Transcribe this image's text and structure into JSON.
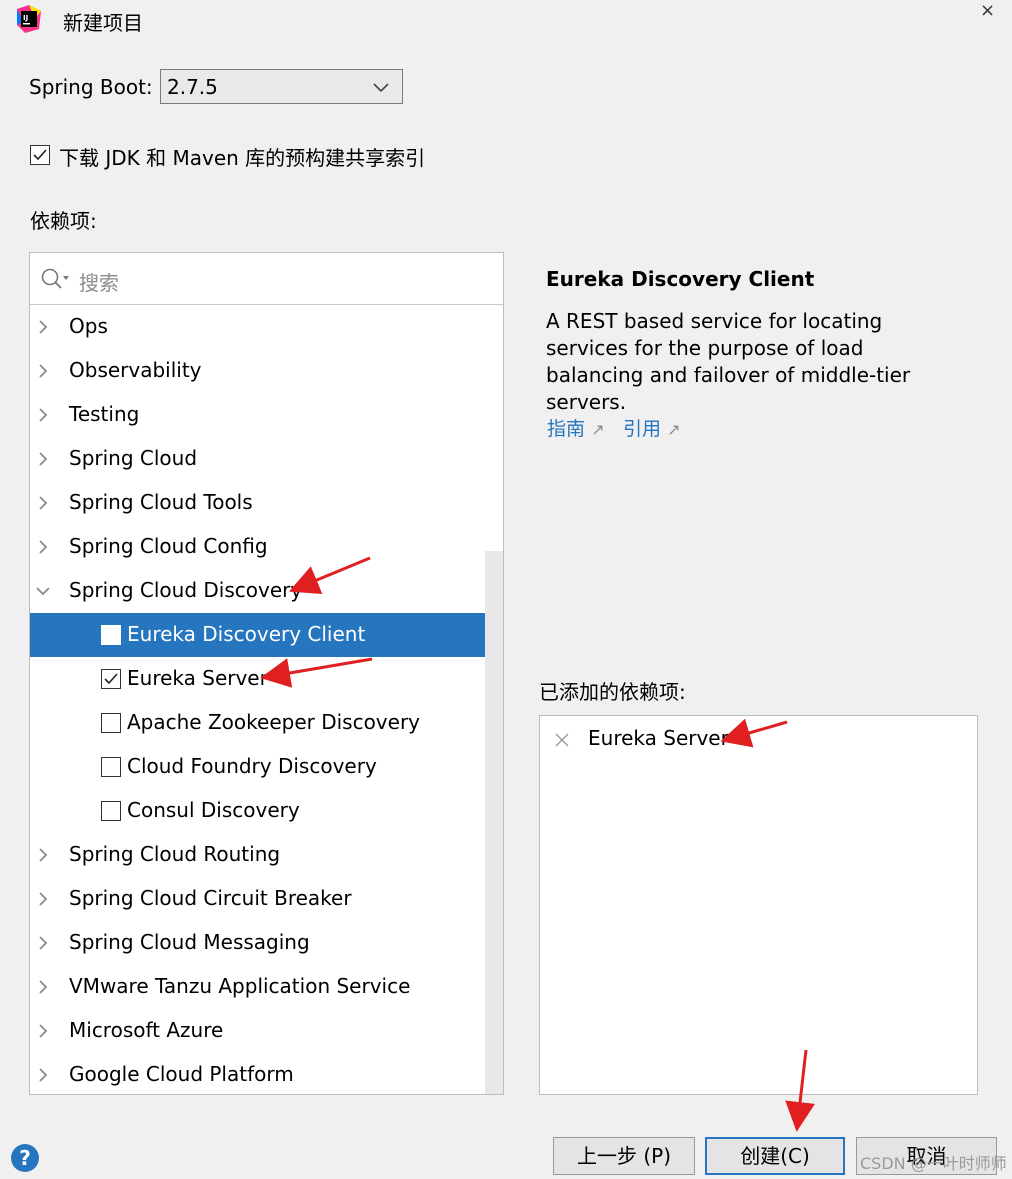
{
  "window": {
    "title": "新建项目",
    "close_symbol": "×"
  },
  "spring_boot": {
    "label": "Spring Boot:",
    "value": "2.7.5"
  },
  "download_index": {
    "label": "下载 JDK 和 Maven 库的预构建共享索引",
    "checked": true
  },
  "dependencies": {
    "label": "依赖项:",
    "search_placeholder": "搜索",
    "rows": [
      {
        "type": "group",
        "label": "Ops",
        "expanded": false
      },
      {
        "type": "group",
        "label": "Observability",
        "expanded": false
      },
      {
        "type": "group",
        "label": "Testing",
        "expanded": false
      },
      {
        "type": "group",
        "label": "Spring Cloud",
        "expanded": false
      },
      {
        "type": "group",
        "label": "Spring Cloud Tools",
        "expanded": false
      },
      {
        "type": "group",
        "label": "Spring Cloud Config",
        "expanded": false
      },
      {
        "type": "group",
        "label": "Spring Cloud Discovery",
        "expanded": true
      },
      {
        "type": "item",
        "label": "Eureka Discovery Client",
        "checked": false,
        "selected": true
      },
      {
        "type": "item",
        "label": "Eureka Server",
        "checked": true,
        "selected": false
      },
      {
        "type": "item",
        "label": "Apache Zookeeper Discovery",
        "checked": false,
        "selected": false
      },
      {
        "type": "item",
        "label": "Cloud Foundry Discovery",
        "checked": false,
        "selected": false
      },
      {
        "type": "item",
        "label": "Consul Discovery",
        "checked": false,
        "selected": false
      },
      {
        "type": "group",
        "label": "Spring Cloud Routing",
        "expanded": false
      },
      {
        "type": "group",
        "label": "Spring Cloud Circuit Breaker",
        "expanded": false
      },
      {
        "type": "group",
        "label": "Spring Cloud Messaging",
        "expanded": false
      },
      {
        "type": "group",
        "label": "VMware Tanzu Application Service",
        "expanded": false
      },
      {
        "type": "group",
        "label": "Microsoft Azure",
        "expanded": false
      },
      {
        "type": "group",
        "label": "Google Cloud Platform",
        "expanded": false
      }
    ]
  },
  "details": {
    "title": "Eureka Discovery Client",
    "description": "A REST based service for locating services for the purpose of load balancing and failover of middle-tier servers.",
    "link_guide": "指南",
    "link_reference": "引用",
    "link_arrow": "↗"
  },
  "added": {
    "label": "已添加的依赖项:",
    "items": [
      "Eureka Server"
    ]
  },
  "buttons": {
    "help": "?",
    "prev": "上一步 (P)",
    "create": "创建(C)",
    "cancel": "取消"
  },
  "watermark": "CSDN @一叶时师师",
  "colors": {
    "accent": "#2675bf",
    "annotation_arrow": "#e02020"
  }
}
